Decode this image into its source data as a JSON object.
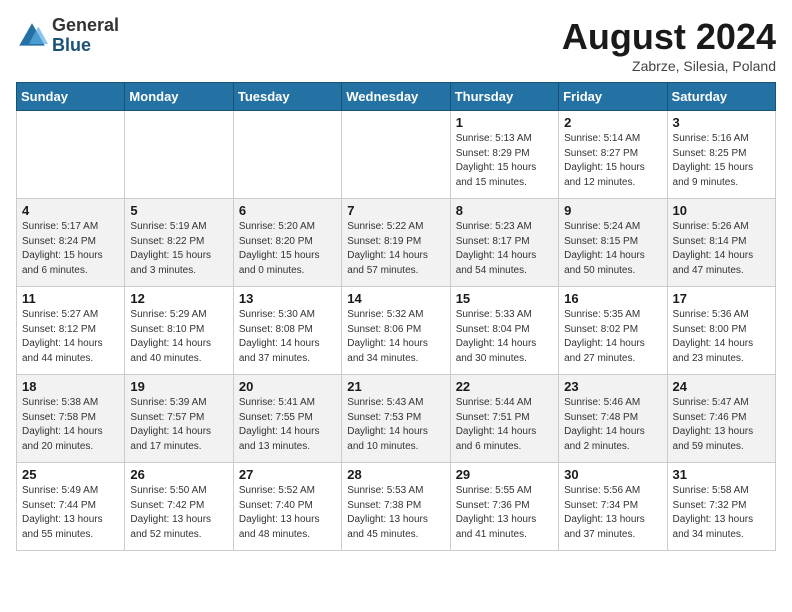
{
  "header": {
    "logo_general": "General",
    "logo_blue": "Blue",
    "month_title": "August 2024",
    "location": "Zabrze, Silesia, Poland"
  },
  "weekdays": [
    "Sunday",
    "Monday",
    "Tuesday",
    "Wednesday",
    "Thursday",
    "Friday",
    "Saturday"
  ],
  "weeks": [
    [
      {
        "day": "",
        "info": ""
      },
      {
        "day": "",
        "info": ""
      },
      {
        "day": "",
        "info": ""
      },
      {
        "day": "",
        "info": ""
      },
      {
        "day": "1",
        "info": "Sunrise: 5:13 AM\nSunset: 8:29 PM\nDaylight: 15 hours\nand 15 minutes."
      },
      {
        "day": "2",
        "info": "Sunrise: 5:14 AM\nSunset: 8:27 PM\nDaylight: 15 hours\nand 12 minutes."
      },
      {
        "day": "3",
        "info": "Sunrise: 5:16 AM\nSunset: 8:25 PM\nDaylight: 15 hours\nand 9 minutes."
      }
    ],
    [
      {
        "day": "4",
        "info": "Sunrise: 5:17 AM\nSunset: 8:24 PM\nDaylight: 15 hours\nand 6 minutes."
      },
      {
        "day": "5",
        "info": "Sunrise: 5:19 AM\nSunset: 8:22 PM\nDaylight: 15 hours\nand 3 minutes."
      },
      {
        "day": "6",
        "info": "Sunrise: 5:20 AM\nSunset: 8:20 PM\nDaylight: 15 hours\nand 0 minutes."
      },
      {
        "day": "7",
        "info": "Sunrise: 5:22 AM\nSunset: 8:19 PM\nDaylight: 14 hours\nand 57 minutes."
      },
      {
        "day": "8",
        "info": "Sunrise: 5:23 AM\nSunset: 8:17 PM\nDaylight: 14 hours\nand 54 minutes."
      },
      {
        "day": "9",
        "info": "Sunrise: 5:24 AM\nSunset: 8:15 PM\nDaylight: 14 hours\nand 50 minutes."
      },
      {
        "day": "10",
        "info": "Sunrise: 5:26 AM\nSunset: 8:14 PM\nDaylight: 14 hours\nand 47 minutes."
      }
    ],
    [
      {
        "day": "11",
        "info": "Sunrise: 5:27 AM\nSunset: 8:12 PM\nDaylight: 14 hours\nand 44 minutes."
      },
      {
        "day": "12",
        "info": "Sunrise: 5:29 AM\nSunset: 8:10 PM\nDaylight: 14 hours\nand 40 minutes."
      },
      {
        "day": "13",
        "info": "Sunrise: 5:30 AM\nSunset: 8:08 PM\nDaylight: 14 hours\nand 37 minutes."
      },
      {
        "day": "14",
        "info": "Sunrise: 5:32 AM\nSunset: 8:06 PM\nDaylight: 14 hours\nand 34 minutes."
      },
      {
        "day": "15",
        "info": "Sunrise: 5:33 AM\nSunset: 8:04 PM\nDaylight: 14 hours\nand 30 minutes."
      },
      {
        "day": "16",
        "info": "Sunrise: 5:35 AM\nSunset: 8:02 PM\nDaylight: 14 hours\nand 27 minutes."
      },
      {
        "day": "17",
        "info": "Sunrise: 5:36 AM\nSunset: 8:00 PM\nDaylight: 14 hours\nand 23 minutes."
      }
    ],
    [
      {
        "day": "18",
        "info": "Sunrise: 5:38 AM\nSunset: 7:58 PM\nDaylight: 14 hours\nand 20 minutes."
      },
      {
        "day": "19",
        "info": "Sunrise: 5:39 AM\nSunset: 7:57 PM\nDaylight: 14 hours\nand 17 minutes."
      },
      {
        "day": "20",
        "info": "Sunrise: 5:41 AM\nSunset: 7:55 PM\nDaylight: 14 hours\nand 13 minutes."
      },
      {
        "day": "21",
        "info": "Sunrise: 5:43 AM\nSunset: 7:53 PM\nDaylight: 14 hours\nand 10 minutes."
      },
      {
        "day": "22",
        "info": "Sunrise: 5:44 AM\nSunset: 7:51 PM\nDaylight: 14 hours\nand 6 minutes."
      },
      {
        "day": "23",
        "info": "Sunrise: 5:46 AM\nSunset: 7:48 PM\nDaylight: 14 hours\nand 2 minutes."
      },
      {
        "day": "24",
        "info": "Sunrise: 5:47 AM\nSunset: 7:46 PM\nDaylight: 13 hours\nand 59 minutes."
      }
    ],
    [
      {
        "day": "25",
        "info": "Sunrise: 5:49 AM\nSunset: 7:44 PM\nDaylight: 13 hours\nand 55 minutes."
      },
      {
        "day": "26",
        "info": "Sunrise: 5:50 AM\nSunset: 7:42 PM\nDaylight: 13 hours\nand 52 minutes."
      },
      {
        "day": "27",
        "info": "Sunrise: 5:52 AM\nSunset: 7:40 PM\nDaylight: 13 hours\nand 48 minutes."
      },
      {
        "day": "28",
        "info": "Sunrise: 5:53 AM\nSunset: 7:38 PM\nDaylight: 13 hours\nand 45 minutes."
      },
      {
        "day": "29",
        "info": "Sunrise: 5:55 AM\nSunset: 7:36 PM\nDaylight: 13 hours\nand 41 minutes."
      },
      {
        "day": "30",
        "info": "Sunrise: 5:56 AM\nSunset: 7:34 PM\nDaylight: 13 hours\nand 37 minutes."
      },
      {
        "day": "31",
        "info": "Sunrise: 5:58 AM\nSunset: 7:32 PM\nDaylight: 13 hours\nand 34 minutes."
      }
    ]
  ]
}
